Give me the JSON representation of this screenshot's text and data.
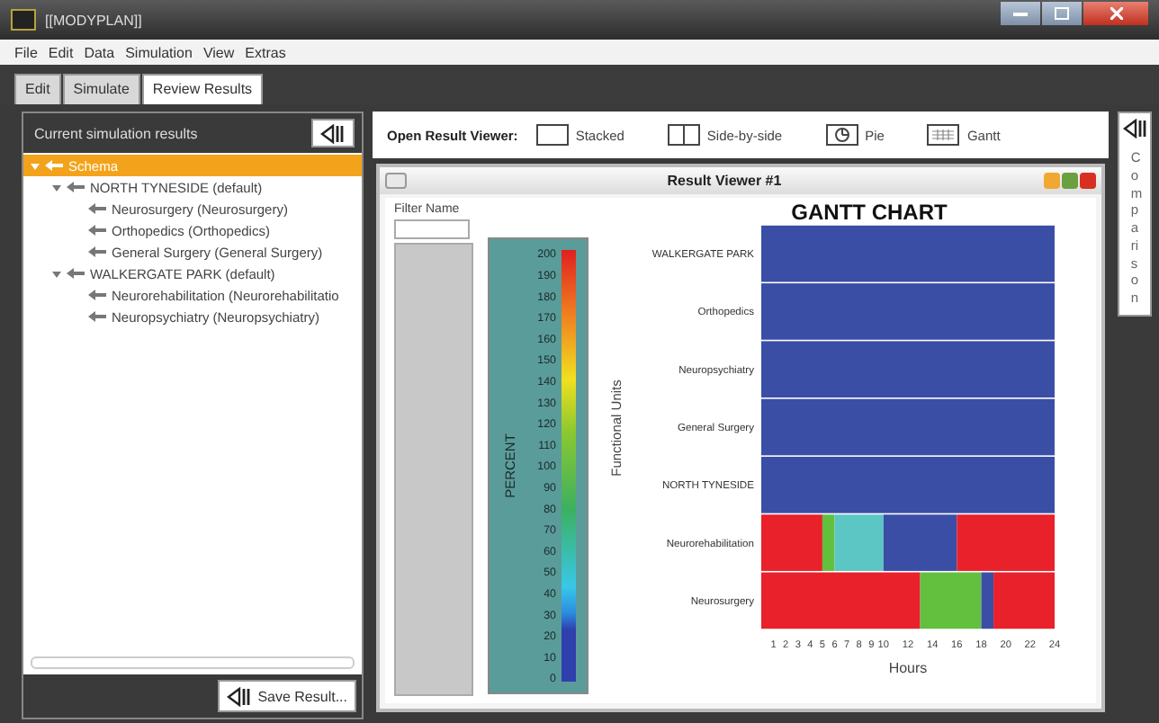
{
  "window": {
    "title": "[[MODYPLAN]]"
  },
  "menu": [
    "File",
    "Edit",
    "Data",
    "Simulation",
    "View",
    "Extras"
  ],
  "tabs": [
    {
      "label": "Edit",
      "selected": false
    },
    {
      "label": "Simulate",
      "selected": false
    },
    {
      "label": "Review Results",
      "selected": true
    }
  ],
  "results_panel": {
    "title": "Current simulation results",
    "tree": [
      {
        "label": "Schema",
        "selected": true,
        "expanded": true,
        "children": [
          {
            "label": "NORTH TYNESIDE (default)",
            "selected": false,
            "expanded": true,
            "children": [
              {
                "label": "Neurosurgery (Neurosurgery)",
                "selected": false
              },
              {
                "label": "Orthopedics (Orthopedics)",
                "selected": false
              },
              {
                "label": "General Surgery (General Surgery)",
                "selected": false
              }
            ]
          },
          {
            "label": "WALKERGATE PARK (default)",
            "selected": false,
            "expanded": true,
            "children": [
              {
                "label": "Neurorehabilitation (Neurorehabilitatio",
                "selected": false
              },
              {
                "label": "Neuropsychiatry (Neuropsychiatry)",
                "selected": false
              }
            ]
          }
        ]
      }
    ],
    "save_button": "Save Result..."
  },
  "viewer_toolbar": {
    "label": "Open Result Viewer:",
    "buttons": [
      {
        "kind": "stacked",
        "label": "Stacked"
      },
      {
        "kind": "side_by_side",
        "label": "Side-by-side"
      },
      {
        "kind": "pie",
        "label": "Pie"
      },
      {
        "kind": "gantt",
        "label": "Gantt"
      }
    ]
  },
  "comparison_panel": {
    "label": "Comparison"
  },
  "result_viewer": {
    "title": "Result Viewer #1",
    "filter": {
      "label": "Filter Name"
    },
    "color_scale": {
      "label": "PERCENT",
      "ticks": [
        "200",
        "190",
        "180",
        "170",
        "160",
        "150",
        "140",
        "130",
        "120",
        "110",
        "100",
        "90",
        "80",
        "70",
        "60",
        "50",
        "40",
        "30",
        "20",
        "10",
        "0"
      ]
    },
    "chart_data": {
      "type": "bar",
      "orientation": "horizontal",
      "stacked": true,
      "title": "GANTT CHART",
      "xlabel": "Hours",
      "ylabel": "Functional Units",
      "categories": [
        "WALKERGATE PARK",
        "Orthopedics",
        "Neuropsychiatry",
        "General Surgery",
        "NORTH TYNESIDE",
        "Neurorehabilitation",
        "Neurosurgery"
      ],
      "xlim": [
        0,
        24
      ],
      "xticks": [
        1,
        2,
        3,
        4,
        5,
        6,
        7,
        8,
        9,
        10,
        12,
        14,
        16,
        18,
        20,
        22,
        24
      ],
      "series": [
        {
          "color": "#e8212b",
          "values": [
            0,
            0,
            0,
            0,
            0,
            5,
            13
          ]
        },
        {
          "color": "#62c03e",
          "values": [
            0,
            0,
            0,
            0,
            0,
            1,
            5
          ]
        },
        {
          "color": "#5cc6c4",
          "values": [
            0,
            0,
            0,
            0,
            0,
            4,
            0
          ]
        },
        {
          "color": "#3b4ea6",
          "values": [
            24,
            24,
            24,
            24,
            24,
            6,
            1
          ]
        },
        {
          "color": "#e8212b",
          "values": [
            0,
            0,
            0,
            0,
            0,
            8,
            5
          ]
        }
      ]
    }
  }
}
